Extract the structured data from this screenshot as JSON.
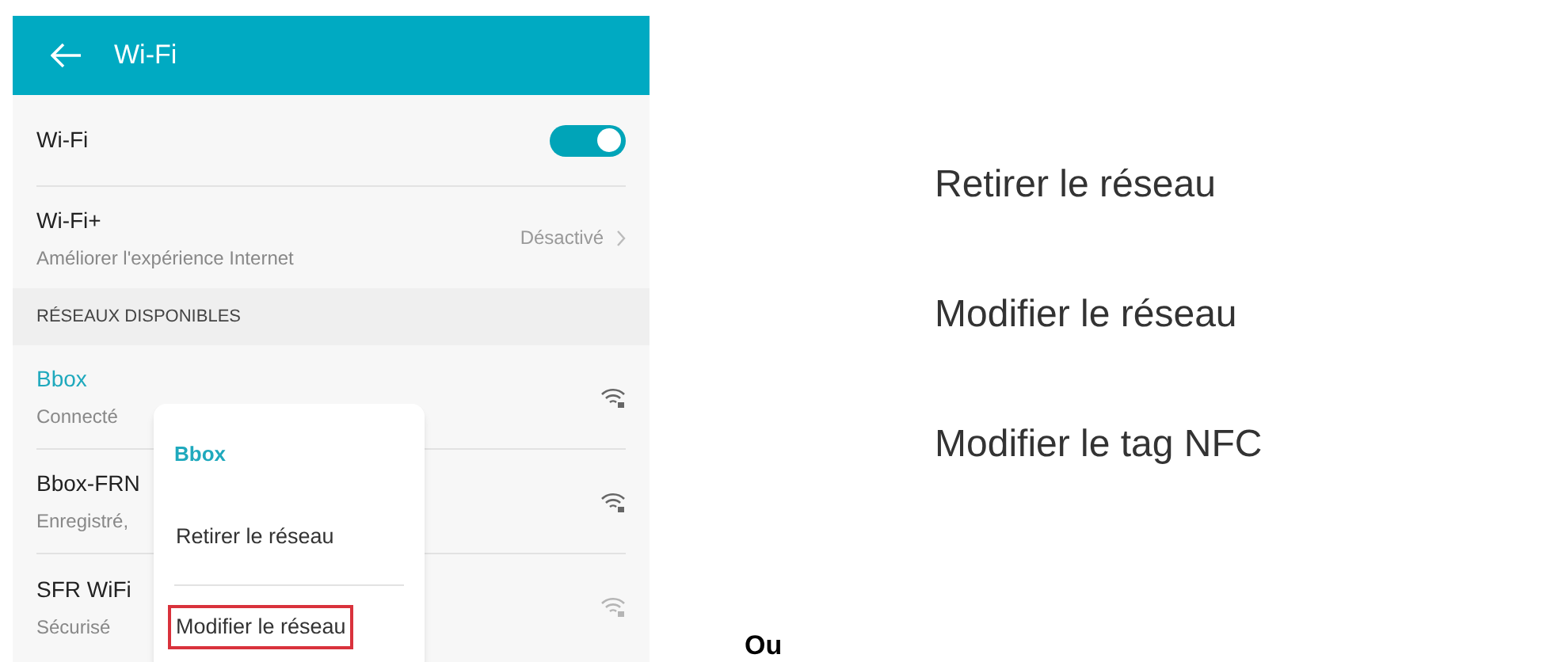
{
  "screen": {
    "title": "Wi-Fi",
    "wifi": {
      "label": "Wi-Fi",
      "on": true
    },
    "wifi_plus": {
      "label": "Wi-Fi+",
      "subtitle": "Améliorer l'expérience Internet",
      "value": "Désactivé"
    },
    "section": "RÉSEAUX DISPONIBLES",
    "networks": [
      {
        "name": "Bbox",
        "status": "Connecté",
        "connected": true
      },
      {
        "name": "Bbox-FRN",
        "status": "Enregistré,",
        "connected": false
      },
      {
        "name": "SFR WiFi",
        "status": "Sécurisé",
        "connected": false
      }
    ]
  },
  "popup": {
    "title": "Bbox",
    "items": [
      {
        "label": "Retirer le réseau",
        "highlighted": false
      },
      {
        "label": "Modifier le réseau",
        "highlighted": true
      }
    ]
  },
  "separator": "Ou",
  "zoomed_menu": [
    "Retirer le réseau",
    "Modifier le réseau",
    "Modifier le tag NFC"
  ]
}
